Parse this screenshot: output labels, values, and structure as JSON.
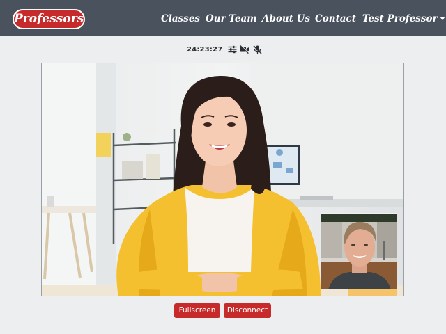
{
  "brand": {
    "label": "Professors"
  },
  "nav": {
    "classes": "Classes",
    "team": "Our Team",
    "about": "About Us",
    "contact": "Contact",
    "user": "Test Professor"
  },
  "call": {
    "timer": "24:23:27",
    "icons": [
      "settings-sliders-icon",
      "camera-off-icon",
      "mic-off-icon"
    ]
  },
  "controls": {
    "fullscreen": "Fullscreen",
    "disconnect": "Disconnect"
  },
  "colors": {
    "navbar": "#4a525e",
    "accent": "#c62a2a",
    "page_background": "#eceef0"
  }
}
